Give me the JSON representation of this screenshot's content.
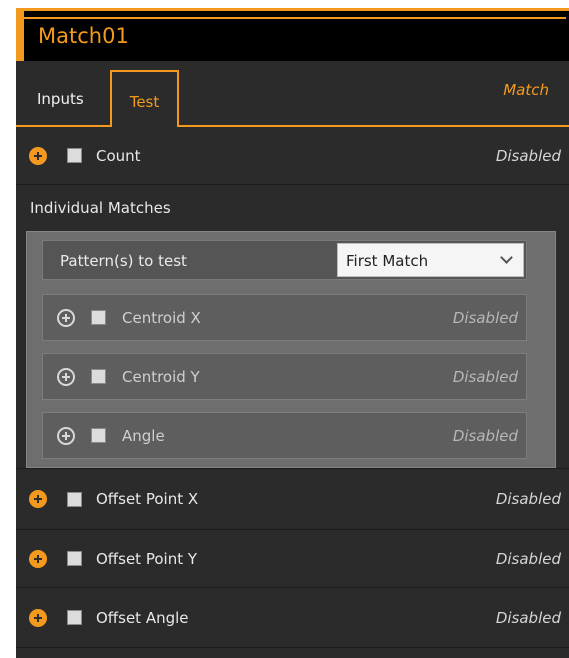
{
  "title": "Match01",
  "tabs": {
    "inputs_label": "Inputs",
    "test_label": "Test",
    "context_label": "Match"
  },
  "rows": {
    "count": {
      "label": "Count",
      "status": "Disabled"
    },
    "individual_matches": {
      "label": "Individual Matches"
    },
    "pattern": {
      "label": "Pattern(s) to test",
      "selected": "First Match"
    },
    "centroid_x": {
      "label": "Centroid X",
      "status": "Disabled"
    },
    "centroid_y": {
      "label": "Centroid Y",
      "status": "Disabled"
    },
    "angle": {
      "label": "Angle",
      "status": "Disabled"
    },
    "offset_point_x": {
      "label": "Offset Point X",
      "status": "Disabled"
    },
    "offset_point_y": {
      "label": "Offset Point Y",
      "status": "Disabled"
    },
    "offset_angle": {
      "label": "Offset Angle",
      "status": "Disabled"
    }
  },
  "colors": {
    "accent": "#f39a1e",
    "panel_bg": "#2b2b2b",
    "group_bg": "#6e6e6e"
  },
  "icons": {
    "expand": "plus-circle-icon",
    "collapse": "minus-circle-icon",
    "dropdown": "chevron-down-icon"
  }
}
